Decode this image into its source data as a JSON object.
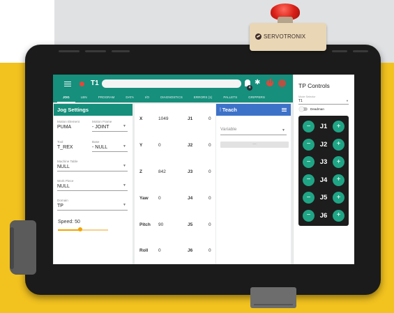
{
  "brand": {
    "name": "SERVOTRONIX"
  },
  "colors": {
    "primary": "#168f7c",
    "teach_header": "#3d72c9",
    "jog_button": "#1fa585",
    "alert": "#e2463a",
    "slider": "#f0a400",
    "background_yellow": "#f2c21f"
  },
  "appbar": {
    "title": "T1",
    "command_value": "",
    "notification_count": "4"
  },
  "tabs": [
    {
      "label": "JOG",
      "active": true
    },
    {
      "label": "LBN",
      "active": false
    },
    {
      "label": "PROGRAM",
      "active": false
    },
    {
      "label": "DATA",
      "active": false
    },
    {
      "label": "I/O",
      "active": false
    },
    {
      "label": "DIAGNOSTICS",
      "active": false
    },
    {
      "label": "ERRORS (1)",
      "active": false
    },
    {
      "label": "PALLETS",
      "active": false
    },
    {
      "label": "GRIPPERS",
      "active": false
    }
  ],
  "jog_settings": {
    "title": "Jog Settings",
    "motion_element": {
      "label": "Motion Element",
      "value": "PUMA"
    },
    "motion_frame": {
      "label": "Motion Frame",
      "value": "- JOINT"
    },
    "tool": {
      "label": "Tool",
      "value": "T_REX"
    },
    "base": {
      "label": "Base",
      "value": "- NULL"
    },
    "machine_table": {
      "label": "Machine Table",
      "value": "NULL"
    },
    "work_piece": {
      "label": "Work Piece",
      "value": "NULL"
    },
    "domain": {
      "label": "Domain",
      "value": "TP"
    },
    "speed_label": "Speed: 50",
    "speed_value": 50
  },
  "coordinates": [
    {
      "axis": "X",
      "value": "1049",
      "joint": "J1",
      "joint_value": "0"
    },
    {
      "axis": "Y",
      "value": "0",
      "joint": "J2",
      "joint_value": "0"
    },
    {
      "axis": "Z",
      "value": "842",
      "joint": "J3",
      "joint_value": "0"
    },
    {
      "axis": "Yaw",
      "value": "0",
      "joint": "J4",
      "joint_value": "0"
    },
    {
      "axis": "Pitch",
      "value": "90",
      "joint": "J5",
      "joint_value": "0"
    },
    {
      "axis": "Roll",
      "value": "0",
      "joint": "J6",
      "joint_value": "0"
    }
  ],
  "teach": {
    "title": "Teach",
    "variable_placeholder": "Variable",
    "button_label": "—"
  },
  "tp_controls": {
    "title": "TP Controls",
    "mode_label": "Mode Selector",
    "mode_value": "T1",
    "deadman_label": "Deadman",
    "deadman_on": false,
    "joints": [
      "J1",
      "J2",
      "J3",
      "J4",
      "J5",
      "J6"
    ],
    "minus_label": "−",
    "plus_label": "+"
  },
  "icons": [
    "menu-icon",
    "power-icon",
    "bell-icon",
    "gear-icon",
    "user-icon",
    "teach-icon",
    "teach-menu-icon",
    "dropdown-caret-icon",
    "brand-logo-icon",
    "estop-icon"
  ]
}
